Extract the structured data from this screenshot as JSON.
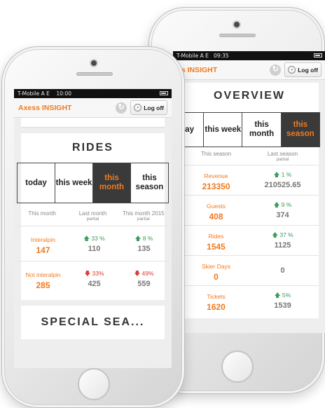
{
  "app": {
    "brand": "Axess INSIGHT",
    "logoff_label": "Log off"
  },
  "colors": {
    "accent": "#f07a1f",
    "up": "#3c9d5a",
    "down": "#e03a2f"
  },
  "icons": {
    "refresh": "refresh-icon",
    "lock": "lock-icon"
  },
  "back_phone": {
    "status": {
      "carrier": "T-Mobile A  E",
      "time": "09:35"
    },
    "title": "OVERVIEW",
    "brand_visible": "ss INSIGHT",
    "periods": [
      {
        "label": "day",
        "active": false
      },
      {
        "label": "this week",
        "active": false
      },
      {
        "label": "this month",
        "active": false
      },
      {
        "label": "this season",
        "active": true
      }
    ],
    "col_current": "This season",
    "col_previous": "Last season",
    "col_previous_sub": "partial",
    "rows": [
      {
        "label": "Revenue",
        "value": "213350",
        "change": "1 %",
        "direction": "up",
        "previous": "210525.65"
      },
      {
        "label": "Guests",
        "value": "408",
        "change": "9 %",
        "direction": "up",
        "previous": "374"
      },
      {
        "label": "Rides",
        "value": "1545",
        "change": "37 %",
        "direction": "up",
        "previous": "1125"
      },
      {
        "label": "Skier Days",
        "value": "0",
        "change": "",
        "direction": "none",
        "previous": "0"
      },
      {
        "label": "Tickets",
        "value": "1620",
        "change": "5%",
        "direction": "up",
        "previous": "1539"
      }
    ]
  },
  "front_phone": {
    "status": {
      "carrier": "T-Mobile A  E",
      "time": "10:00"
    },
    "title": "RIDES",
    "periods": [
      {
        "label": "today",
        "active": false
      },
      {
        "label": "this week",
        "active": false
      },
      {
        "label": "this month",
        "active": true
      },
      {
        "label": "this season",
        "active": false
      }
    ],
    "col1": "This month",
    "col2": "Last month",
    "col2_sub": "partial",
    "col3": "This month 2015",
    "col3_sub": "partial",
    "rows": [
      {
        "label": "Interalpin",
        "value": "147",
        "change1": "33 %",
        "dir1": "up",
        "prev1": "110",
        "change2": "8 %",
        "dir2": "up",
        "prev2": "135"
      },
      {
        "label": "Not interalpin",
        "value": "285",
        "change1": "33%",
        "dir1": "down",
        "prev1": "425",
        "change2": "49%",
        "dir2": "down",
        "prev2": "559"
      }
    ],
    "next_section": "SPECIAL SEA..."
  }
}
